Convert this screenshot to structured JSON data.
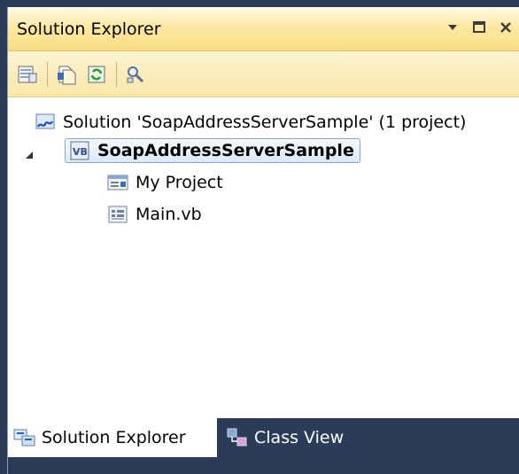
{
  "window": {
    "title": "Solution Explorer",
    "controls": [
      "dropdown-icon",
      "maximize-icon",
      "close-icon"
    ]
  },
  "toolbar": {
    "buttons": [
      "properties-icon",
      "show-all-files-icon",
      "refresh-icon",
      "view-class-diagram-icon"
    ]
  },
  "tree": {
    "solution_label": "Solution 'SoapAddressServerSample' (1 project)",
    "project_label": "SoapAddressServerSample",
    "items": [
      {
        "label": "My Project",
        "icon": "my-project-icon"
      },
      {
        "label": "Main.vb",
        "icon": "vb-file-icon"
      }
    ]
  },
  "tabs": {
    "solution_explorer": "Solution Explorer",
    "class_view": "Class View"
  },
  "colors": {
    "frame": "#2b3c59",
    "title_bar": "#fde9a3",
    "selection_border": "#7ea6dc"
  }
}
